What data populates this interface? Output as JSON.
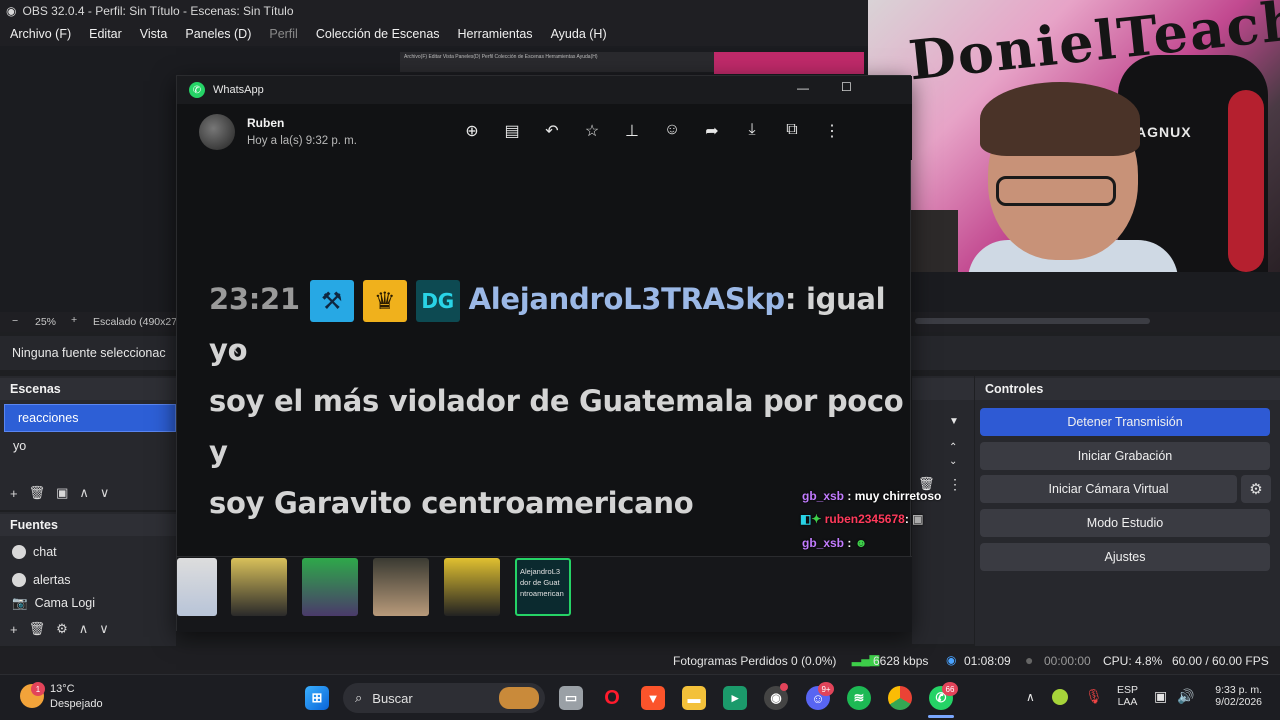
{
  "obs": {
    "title": "OBS 32.0.4 - Perfil: Sin Título - Escenas: Sin Título",
    "menu": [
      "Archivo (F)",
      "Editar",
      "Vista",
      "Paneles (D)",
      "Perfil",
      "Colección de Escenas",
      "Herramientas",
      "Ayuda (H)"
    ],
    "zoom": "25%",
    "scale_label": "Escalado (490x27",
    "no_source": "Ninguna fuente seleccionac",
    "scenes_title": "Escenas",
    "scenes": [
      "reacciones",
      "yo"
    ],
    "sources_title": "Fuentes",
    "sources": [
      "chat",
      "alertas",
      "Cama Logi"
    ],
    "controls_title": "Controles",
    "controls": {
      "stream": "Detener Transmisión",
      "record": "Iniciar Grabación",
      "virtual_cam": "Iniciar Cámara Virtual",
      "studio": "Modo Estudio",
      "settings": "Ajustes"
    },
    "status": {
      "dropped": "Fotogramas Perdidos 0 (0.0%)",
      "bitrate": "6628 kbps",
      "stream_time": "01:08:09",
      "rec_time": "00:00:00",
      "cpu": "CPU: 4.8%",
      "fps": "60.00 / 60.00 FPS"
    }
  },
  "webcam": {
    "graffiti": "DonielTeach",
    "chair_brand": "AGNUX"
  },
  "whatsapp": {
    "title": "WhatsApp",
    "contact": "Ruben",
    "time": "Hoy a la(s) 9:32 p. m.",
    "message": {
      "timestamp": "23:21",
      "user": "AlejandroL3TRASkp",
      "text_1": ": igual yo",
      "text_2": "soy el más violador de Guatemala por poco y",
      "text_3": "soy Garavito centroamericano"
    },
    "badge_3": "DG",
    "active_thumb": [
      "AlejandroL3",
      "dor de Guat",
      "ntroamerican"
    ]
  },
  "chat_overlay": [
    {
      "user": "gb_xsb",
      "msg": ": muy chirretoso"
    },
    {
      "user": "ruben2345678",
      "msg": ":"
    },
    {
      "user": "gb_xsb",
      "msg": ":"
    }
  ],
  "taskbar": {
    "temp": "13°C",
    "weather": "Despejado",
    "weather_badge": "1",
    "search": "Buscar",
    "discord_badge": "9+",
    "whatsapp_badge": "66",
    "lang_1": "ESP",
    "lang_2": "LAA",
    "clock": "9:33 p. m.",
    "date": "9/02/2026"
  },
  "colors": {
    "accent": "#2e5ad4",
    "whatsapp": "#25d366"
  }
}
